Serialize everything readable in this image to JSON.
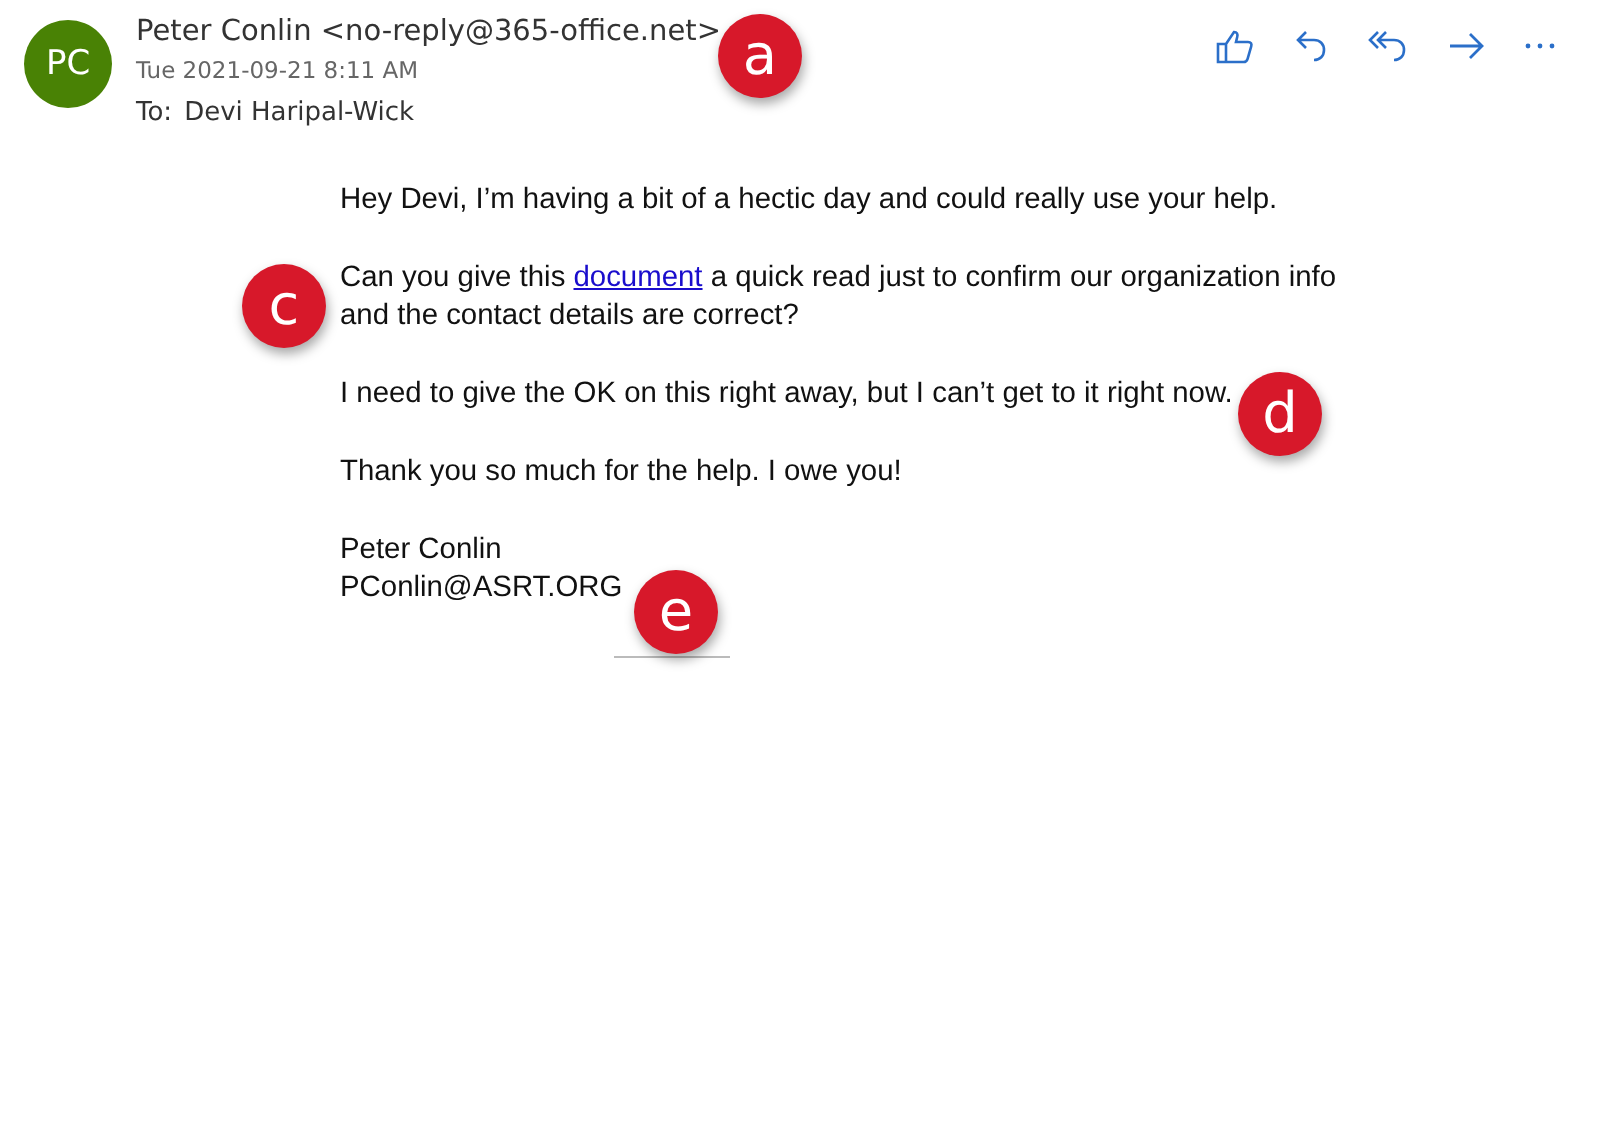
{
  "header": {
    "avatar_initials": "PC",
    "sender": "Peter Conlin <no-reply@365-office.net>",
    "date": "Tue 2021-09-21 8:11 AM",
    "to_label": "To:",
    "to": "Devi Haripal-Wick"
  },
  "toolbar": [
    {
      "kind": "like"
    },
    {
      "kind": "reply"
    },
    {
      "kind": "reply_all"
    },
    {
      "kind": "forward"
    },
    {
      "kind": "more"
    }
  ],
  "body": [
    {
      "kind": "text",
      "text": "Hey Devi, I’m having a bit of a hectic day and could really use your help."
    },
    {
      "kind": "link",
      "before": "Can you give this ",
      "link": "document",
      "after": " a quick read just to confirm our organization info and the contact details are correct?"
    },
    {
      "kind": "text",
      "text": "I need to give the OK on this right away, but I can’t get to it right now."
    },
    {
      "kind": "text",
      "text": "Thank you so much for the help. I owe you!"
    }
  ],
  "signature": [
    "Peter Conlin",
    "PConlin@ASRT.ORG"
  ],
  "callouts": [
    {
      "label": "a"
    },
    {
      "label": "c"
    },
    {
      "label": "d"
    },
    {
      "label": "e"
    }
  ]
}
